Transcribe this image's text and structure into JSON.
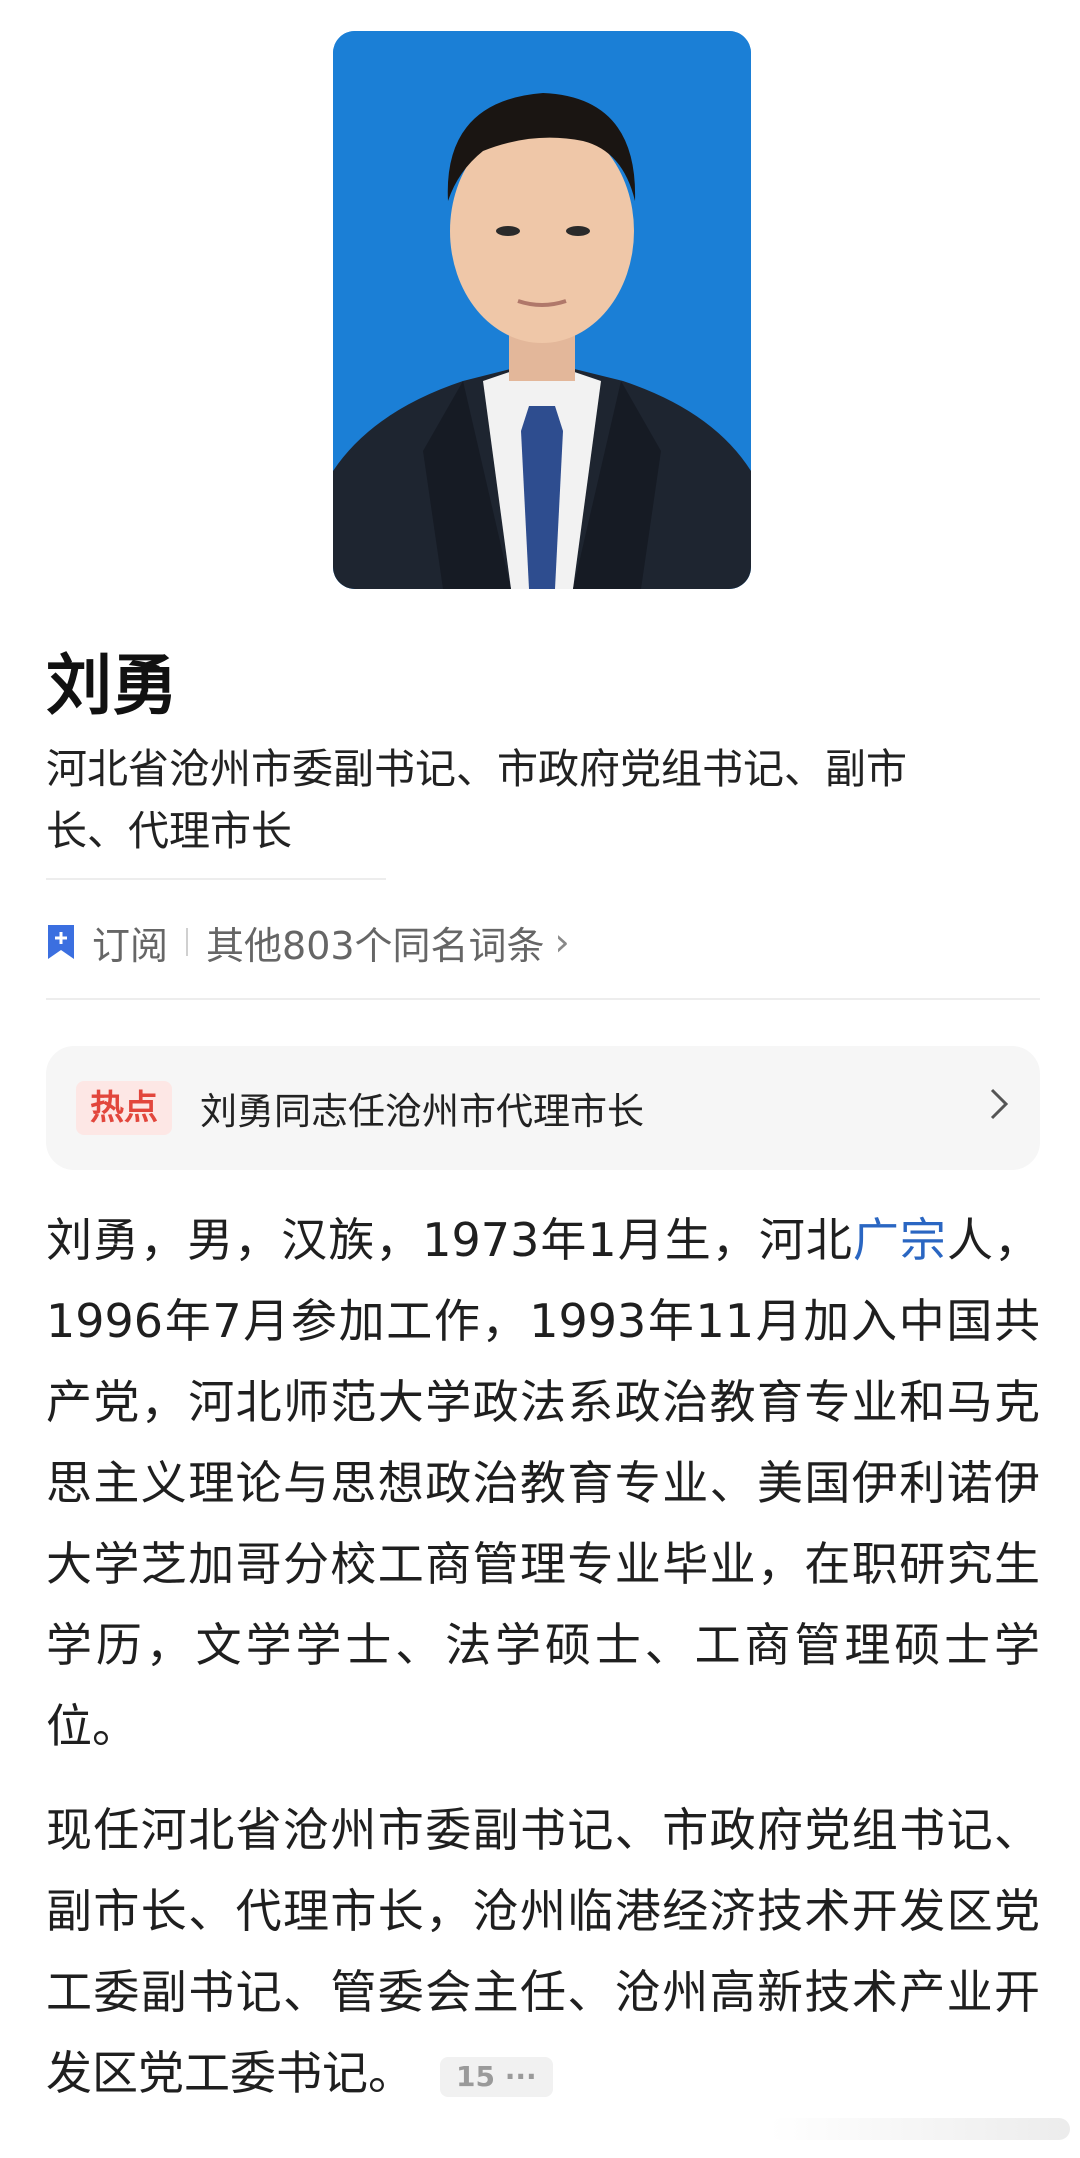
{
  "profile": {
    "name": "刘勇",
    "subtitle": "河北省沧州市委副书记、市政府党组书记、副市长、代理市长",
    "photo_bg": "#1b7fd6"
  },
  "actions": {
    "subscribe_label": "订阅",
    "same_name_label": "其他803个同名词条",
    "chevron": "›"
  },
  "hot": {
    "badge": "热点",
    "title": "刘勇同志任沧州市代理市长"
  },
  "body": {
    "p1_before": "刘勇，男，汉族，1973年1月生，河北",
    "p1_link": "广宗",
    "p1_after": "人，1996年7月参加工作，1993年11月加入中国共产党，河北师范大学政法系政治教育专业和马克思主义理论与思想政治教育专业、美国伊利诺伊大学芝加哥分校工商管理专业毕业，在职研究生学历，文学学士、法学硕士、工商管理硕士学位。",
    "p2": "现任河北省沧州市委副书记、市政府党组书记、副市长、代理市长，沧州临港经济技术开发区党工委副书记、管委会主任、沧州高新技术产业开发区党工委书记。",
    "ref_badge": "15 ···"
  },
  "colors": {
    "accent_blue": "#2a66c2",
    "hot_red": "#e2463c",
    "bookmark_blue": "#3b6fe0"
  }
}
